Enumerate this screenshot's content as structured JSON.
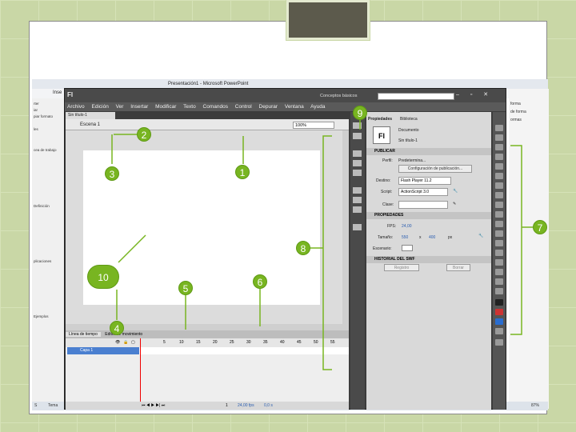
{
  "powerpoint": {
    "title": "Presentación1 - Microsoft PowerPoint",
    "tab_insert": "Inse",
    "left_panel": [
      "rter",
      "iar",
      "piar formato",
      "les",
      "cea de trabajo",
      "Definición",
      "plicaciones",
      "Ejemplos"
    ],
    "right_panel": [
      "forma",
      "de forma",
      "ormas"
    ],
    "status_left": "S",
    "status_tema": "Tema",
    "status_zoom": "87%"
  },
  "flash": {
    "logo": "Fl",
    "workspace": "Conceptos básicos",
    "menu": [
      "Archivo",
      "Edición",
      "Ver",
      "Insertar",
      "Modificar",
      "Texto",
      "Comandos",
      "Control",
      "Depurar",
      "Ventana",
      "Ayuda"
    ],
    "doc_tab": "Sin título-1",
    "scene": "Escena 1",
    "zoom": "100%",
    "timeline_tabs": [
      "Línea de tiempo",
      "Editor de movimiento"
    ],
    "frame_numbers": [
      "5",
      "10",
      "15",
      "20",
      "25",
      "30",
      "35",
      "40",
      "45",
      "50",
      "55"
    ],
    "layer_name": "Capa 1",
    "timeline_status": {
      "fps": "24,00 fps",
      "time": "0,0 s",
      "frame": "1"
    }
  },
  "properties": {
    "tabs": [
      "Propiedades",
      "Biblioteca"
    ],
    "doc_icon": "Fl",
    "doc_type": "Documento",
    "doc_name": "Sin título-1",
    "publish_header": "PUBLICAR",
    "profile_label": "Perfil:",
    "profile_value": "Predetermina...",
    "publish_settings_button": "Configuración de publicación...",
    "target_label": "Destino:",
    "target_value": "Flash Player 11.2",
    "script_label": "Script:",
    "script_value": "ActionScript 3.0",
    "class_label": "Clase:",
    "props_header": "PROPIEDADES",
    "fps_label": "FPS:",
    "fps_value": "24,00",
    "size_label": "Tamaño:",
    "width_value": "550",
    "x_sep": "x",
    "height_value": "400",
    "unit": "px",
    "stage_label": "Escenario:",
    "swf_header": "HISTORIAL DEL SWF",
    "log_button": "Registro",
    "delete_button": "Borrar"
  },
  "callouts": [
    "1",
    "2",
    "3",
    "4",
    "5",
    "6",
    "7",
    "8",
    "9",
    "10"
  ],
  "colors": {
    "callout": "#78b521",
    "background": "#c9d7a6",
    "flash_dark": "#3c3c3c",
    "playhead": "#e00000"
  }
}
